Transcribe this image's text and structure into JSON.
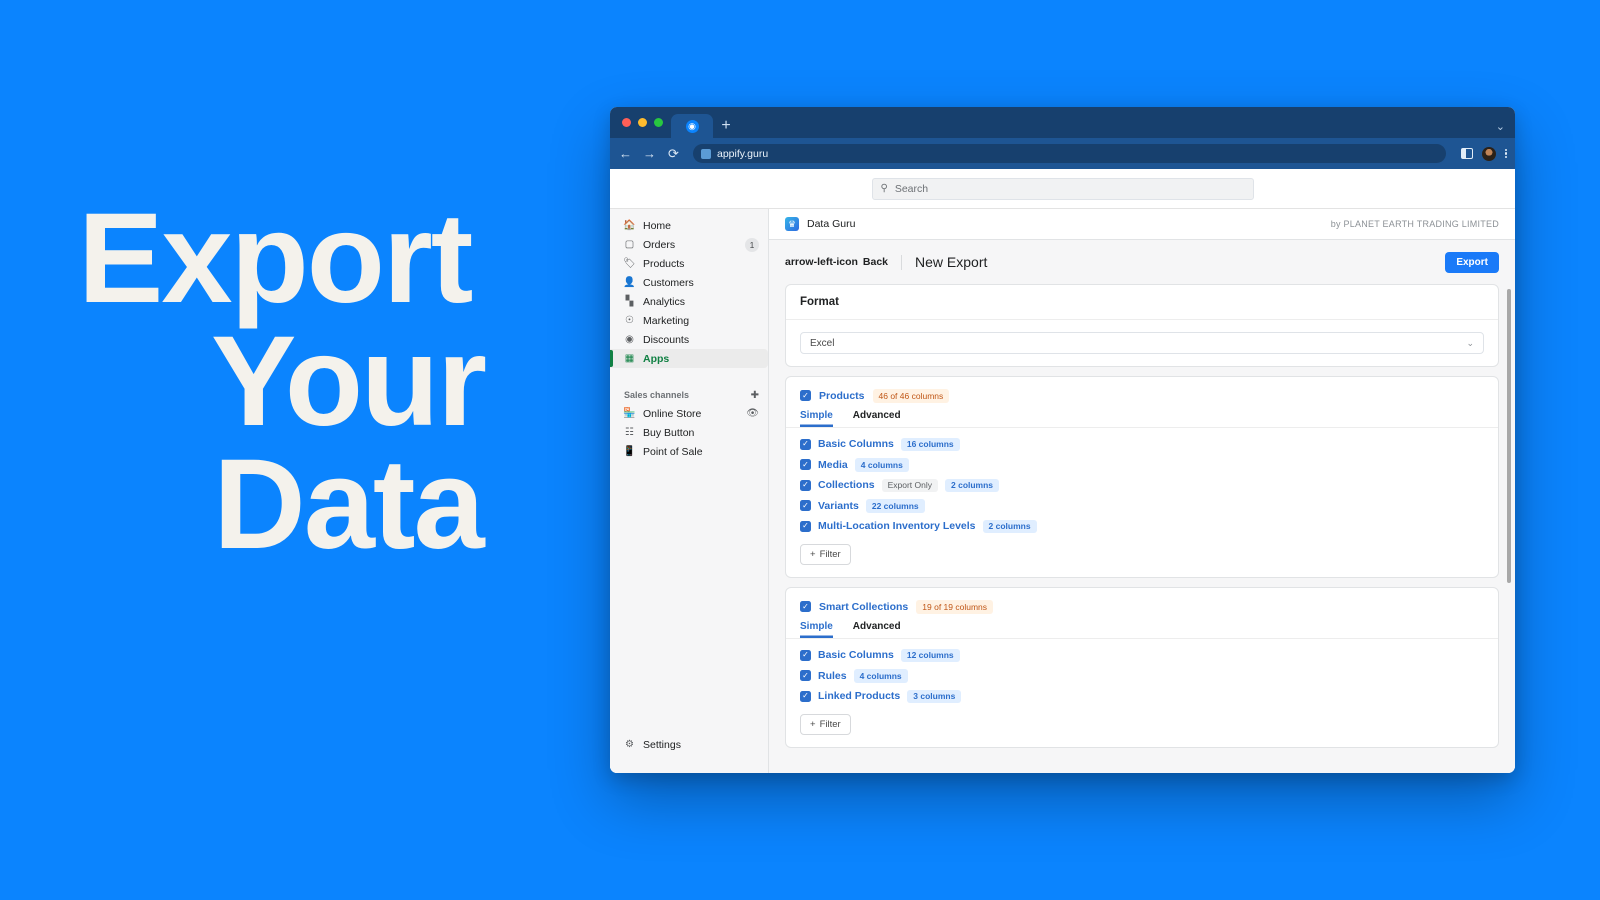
{
  "promo": {
    "line1": "Export",
    "line2": "Your",
    "line3": "Data",
    "bg_color": "#0b84fe",
    "text_color": "#f4f2ec"
  },
  "browser": {
    "tab": {
      "favicon": "globe-icon",
      "new_tab_label": "+"
    },
    "tabstrip_chevron": "⌄",
    "nav": {
      "back": "←",
      "forward": "→",
      "reload": "⟳"
    },
    "url": "appify.guru",
    "right_icons": [
      "sidebar-toggle-icon",
      "avatar-icon",
      "kebab-menu-icon"
    ]
  },
  "search": {
    "placeholder": "Search",
    "icon": "search-icon"
  },
  "sidebar": {
    "items": [
      {
        "label": "Home",
        "icon": "home-icon",
        "badge": ""
      },
      {
        "label": "Orders",
        "icon": "orders-icon",
        "badge": "1"
      },
      {
        "label": "Products",
        "icon": "products-tag-icon",
        "badge": ""
      },
      {
        "label": "Customers",
        "icon": "customers-icon",
        "badge": ""
      },
      {
        "label": "Analytics",
        "icon": "analytics-bars-icon",
        "badge": ""
      },
      {
        "label": "Marketing",
        "icon": "marketing-icon",
        "badge": ""
      },
      {
        "label": "Discounts",
        "icon": "discounts-icon",
        "badge": ""
      },
      {
        "label": "Apps",
        "icon": "apps-grid-icon",
        "badge": "",
        "active": true
      }
    ],
    "section": {
      "title": "Sales channels",
      "add_icon": "plus-circle-icon"
    },
    "channels": [
      {
        "label": "Online Store",
        "icon": "online-store-icon",
        "trailing_icon": "eye-icon"
      },
      {
        "label": "Buy Button",
        "icon": "buy-button-icon",
        "trailing_icon": ""
      },
      {
        "label": "Point of Sale",
        "icon": "point-of-sale-icon",
        "trailing_icon": ""
      }
    ],
    "settings": {
      "label": "Settings",
      "icon": "gear-icon"
    }
  },
  "app_header": {
    "logo": "data-guru-logo",
    "name": "Data Guru",
    "by_line": "by PLANET EARTH TRADING LIMITED"
  },
  "page_header": {
    "back_label": "Back",
    "back_icon": "arrow-left-icon",
    "title": "New Export",
    "export_label": "Export"
  },
  "format_card": {
    "title": "Format",
    "selected": "Excel",
    "chevron": "⌄"
  },
  "resources": [
    {
      "name": "Products",
      "summary": "46 of 46 columns",
      "tabs": [
        {
          "label": "Simple",
          "selected": true
        },
        {
          "label": "Advanced",
          "selected": false
        }
      ],
      "rows": [
        {
          "label": "Basic Columns",
          "tags": [],
          "columns": "16 columns"
        },
        {
          "label": "Media",
          "tags": [],
          "columns": "4 columns"
        },
        {
          "label": "Collections",
          "tags": [
            "Export Only"
          ],
          "columns": "2 columns"
        },
        {
          "label": "Variants",
          "tags": [],
          "columns": "22 columns"
        },
        {
          "label": "Multi-Location Inventory Levels",
          "tags": [],
          "columns": "2 columns"
        }
      ],
      "filter_label": "Filter"
    },
    {
      "name": "Smart Collections",
      "summary": "19 of 19 columns",
      "tabs": [
        {
          "label": "Simple",
          "selected": true
        },
        {
          "label": "Advanced",
          "selected": false
        }
      ],
      "rows": [
        {
          "label": "Basic Columns",
          "tags": [],
          "columns": "12 columns"
        },
        {
          "label": "Rules",
          "tags": [],
          "columns": "4 columns"
        },
        {
          "label": "Linked Products",
          "tags": [],
          "columns": "3 columns"
        }
      ],
      "filter_label": "Filter"
    }
  ],
  "colors": {
    "accent_blue": "#2c6ecb",
    "brand_blue": "#0b84fe",
    "green": "#108043",
    "orange": "#c05717"
  }
}
